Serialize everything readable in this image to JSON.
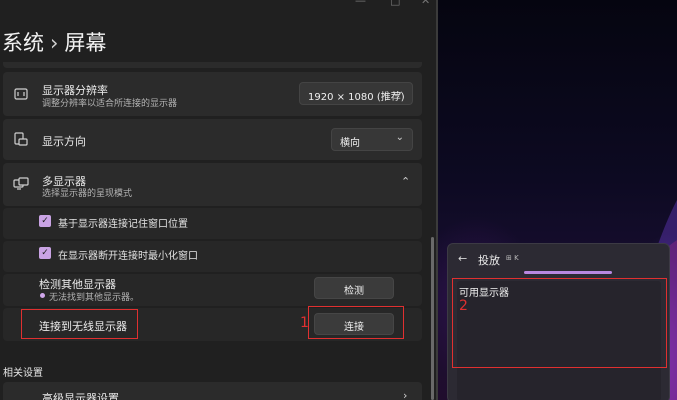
{
  "window": {
    "controls": {
      "minimize": "—",
      "maximize": "□",
      "close": "✕"
    }
  },
  "breadcrumb": {
    "parent": "系统",
    "separator": "›",
    "current": "屏幕"
  },
  "resolution": {
    "title": "显示器分辨率",
    "description": "调整分辨率以适合所连接的显示器",
    "value": "1920 × 1080 (推荐)",
    "icon": "resolution-icon"
  },
  "orientation": {
    "title": "显示方向",
    "value": "横向",
    "icon": "orientation-icon"
  },
  "multi_display": {
    "title": "多显示器",
    "description": "选择显示器的呈现模式",
    "icon": "multi-display-icon",
    "options": [
      {
        "label": "基于显示器连接记住窗口位置",
        "checked": true
      },
      {
        "label": "在显示器断开连接时最小化窗口",
        "checked": true
      }
    ],
    "detect": {
      "title": "检测其他显示器",
      "status": "无法找到其他显示器。",
      "button": "检测"
    },
    "wireless": {
      "title": "连接到无线显示器",
      "button": "连接"
    }
  },
  "related": {
    "section": "相关设置",
    "advanced": "高级显示器设置"
  },
  "annotations": {
    "one": "1",
    "two": "2",
    "color": "#e03030"
  },
  "cast": {
    "back": "←",
    "title": "投放",
    "shortcut": "⊞ K",
    "available_label": "可用显示器"
  },
  "accent": "#c9a3e4"
}
